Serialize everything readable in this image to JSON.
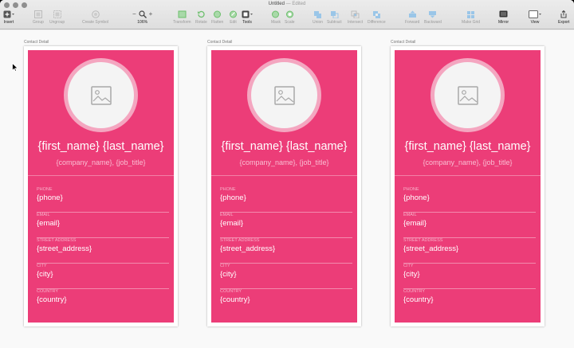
{
  "window": {
    "title": "Untitled",
    "status": "Edited",
    "dash": "—"
  },
  "toolbar": [
    {
      "id": "insert",
      "label": "Insert",
      "icon": "insert-icon",
      "active": true
    },
    {
      "id": "group",
      "label": "Group",
      "icon": "group-icon"
    },
    {
      "id": "ungroup",
      "label": "Ungroup",
      "icon": "ungroup-icon"
    },
    {
      "id": "create-symbol",
      "label": "Create Symbol",
      "icon": "symbol-icon"
    },
    {
      "id": "zoom",
      "label": "106%",
      "icon": "zoom-icon",
      "active": true
    },
    {
      "id": "transform",
      "label": "Transform",
      "icon": "transform-icon"
    },
    {
      "id": "rotate",
      "label": "Rotate",
      "icon": "rotate-icon"
    },
    {
      "id": "flatten",
      "label": "Flatten",
      "icon": "flatten-icon"
    },
    {
      "id": "edit",
      "label": "Edit",
      "icon": "edit-icon"
    },
    {
      "id": "tools",
      "label": "Tools",
      "icon": "tools-icon",
      "active": true
    },
    {
      "id": "mask",
      "label": "Mask",
      "icon": "mask-icon"
    },
    {
      "id": "scale",
      "label": "Scale",
      "icon": "scale-icon"
    },
    {
      "id": "union",
      "label": "Union",
      "icon": "union-icon"
    },
    {
      "id": "subtract",
      "label": "Subtract",
      "icon": "subtract-icon"
    },
    {
      "id": "intersect",
      "label": "Intersect",
      "icon": "intersect-icon"
    },
    {
      "id": "difference",
      "label": "Difference",
      "icon": "difference-icon"
    },
    {
      "id": "forward",
      "label": "Forward",
      "icon": "forward-icon"
    },
    {
      "id": "backward",
      "label": "Backward",
      "icon": "backward-icon"
    },
    {
      "id": "make-grid",
      "label": "Make Grid",
      "icon": "grid-icon"
    },
    {
      "id": "mirror",
      "label": "Mirror",
      "icon": "mirror-icon",
      "active": true
    },
    {
      "id": "view",
      "label": "View",
      "icon": "view-icon",
      "active": true
    },
    {
      "id": "export",
      "label": "Export",
      "icon": "export-icon",
      "active": true
    }
  ],
  "zoom_minus": "−",
  "zoom_plus": "+",
  "artboards": [
    {
      "label": "Contact Detail",
      "name": "{first_name} {last_name}",
      "company": "{company_name}, {job_title}",
      "fields": [
        {
          "label": "PHONE",
          "value": "{phone}"
        },
        {
          "label": "EMAIL",
          "value": "{email}"
        },
        {
          "label": "STREET ADDRESS",
          "value": "{street_address}"
        },
        {
          "label": "CITY",
          "value": "{city}"
        },
        {
          "label": "COUNTRY",
          "value": "{country}"
        }
      ]
    },
    {
      "label": "Contact Detail",
      "name": "{first_name} {last_name}",
      "company": "{company_name}, {job_title}",
      "fields": [
        {
          "label": "PHONE",
          "value": "{phone}"
        },
        {
          "label": "EMAIL",
          "value": "{email}"
        },
        {
          "label": "STREET ADDRESS",
          "value": "{street_address}"
        },
        {
          "label": "CITY",
          "value": "{city}"
        },
        {
          "label": "COUNTRY",
          "value": "{country}"
        }
      ]
    },
    {
      "label": "Contact Detail",
      "name": "{first_name} {last_name}",
      "company": "{company_name}, {job_title}",
      "fields": [
        {
          "label": "PHONE",
          "value": "{phone}"
        },
        {
          "label": "EMAIL",
          "value": "{email}"
        },
        {
          "label": "STREET ADDRESS",
          "value": "{street_address}"
        },
        {
          "label": "CITY",
          "value": "{city}"
        },
        {
          "label": "COUNTRY",
          "value": "{country}"
        }
      ]
    }
  ],
  "colors": {
    "card": "#ec3d78",
    "avatar_ring": "#f4a6c0",
    "accent_tool": "#5cb85c"
  }
}
